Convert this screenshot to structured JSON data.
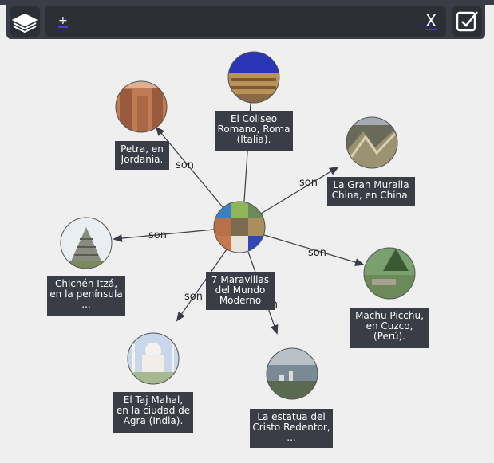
{
  "toolbar": {
    "input_value": "+",
    "clear_label": "X"
  },
  "diagram": {
    "center": {
      "title": "7 Maravillas\ndel Mundo\nModerno"
    },
    "edge_label": "son",
    "nodes": [
      {
        "id": "coliseo",
        "label": "El Coliseo\nRomano, Roma\n(Italia)."
      },
      {
        "id": "petra",
        "label": "Petra, en\nJordania."
      },
      {
        "id": "muralla",
        "label": "La Gran Muralla\nChina, en China."
      },
      {
        "id": "chichen",
        "label": "Chichén Itzá,\nen la península\n..."
      },
      {
        "id": "machu",
        "label": "Machu Picchu,\nen Cuzco,\n(Perú)."
      },
      {
        "id": "taj",
        "label": "El Taj Mahal,\nen la ciudad de\nAgra (India)."
      },
      {
        "id": "cristo",
        "label": "La estatua del\nCristo Redentor,\n..."
      }
    ]
  },
  "colors": {
    "toolbar": "#3a3d45",
    "accent": "#4a3bd6",
    "background": "#efefef",
    "edge": "#3a3d45"
  }
}
